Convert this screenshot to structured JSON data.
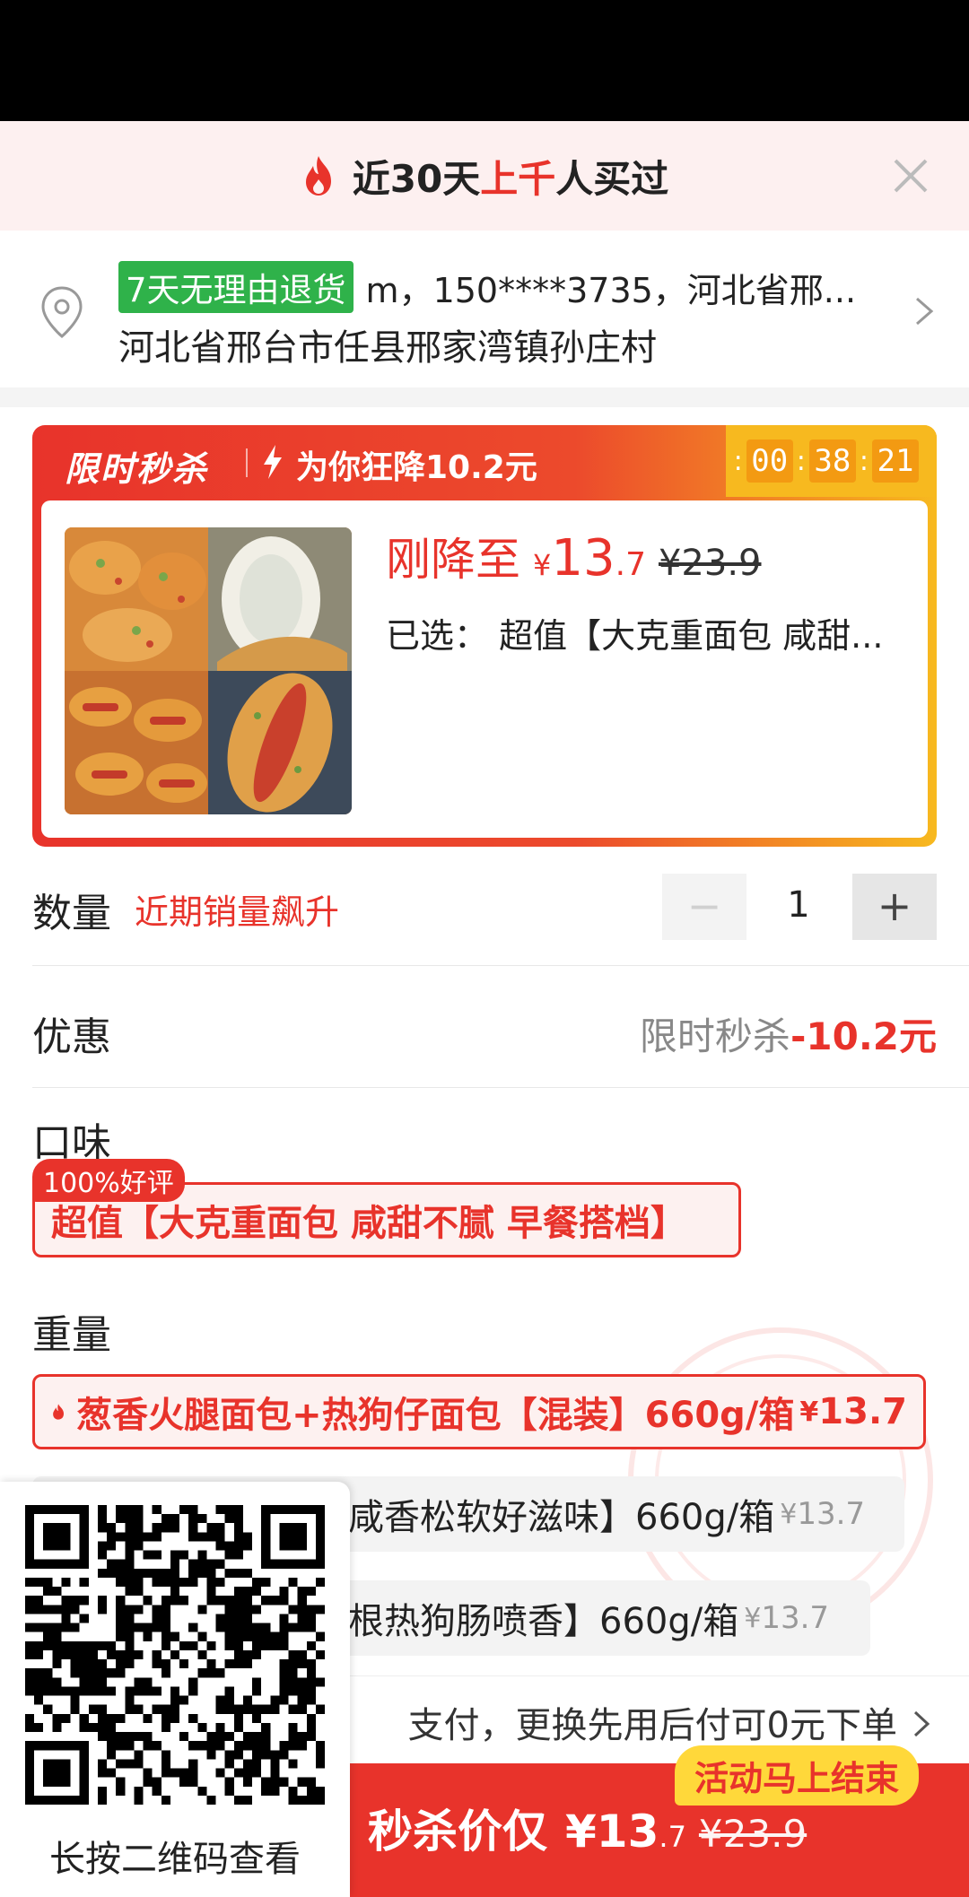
{
  "banner": {
    "text_before": "近30天",
    "text_highlight": "上千",
    "text_after": "人买过"
  },
  "address": {
    "tag": "7天无理由退货",
    "contact": "m，150****3735，河北省邢...",
    "detail": "河北省邢台市任县邢家湾镇孙庄村"
  },
  "flash_sale": {
    "title": "限时秒杀",
    "drop_text": "为你狂降10.2元",
    "timer": [
      "00",
      "38",
      "21"
    ]
  },
  "product": {
    "price_label": "刚降至",
    "currency": "¥",
    "price_int": "13",
    "price_dec": ".7",
    "orig_price": "¥23.9",
    "selected": "已选： 超值【大克重面包 咸甜..."
  },
  "quantity": {
    "label": "数量",
    "hint": "近期销量飙升",
    "minus": "−",
    "value": "1",
    "plus": "+"
  },
  "discount": {
    "label": "优惠",
    "name": "限时秒杀",
    "amount": "-10.2元"
  },
  "flavor": {
    "label": "口味",
    "badge": "100%好评",
    "option": "超值【大克重面包 咸甜不腻  早餐搭档】"
  },
  "weight": {
    "label": "重量",
    "options": [
      {
        "text": "葱香火腿面包+热狗仔面包【混装】660g/箱",
        "yen": "¥",
        "price": "13.7"
      },
      {
        "text": "咸香松软好滋味】660g/箱",
        "yen": "¥",
        "price": "13.7"
      },
      {
        "text": "根热狗肠喷香】660g/箱",
        "yen": "¥",
        "price": "13.7"
      }
    ]
  },
  "payment": {
    "text": "支付，更换先用后付可0元下单"
  },
  "buy": {
    "label": "秒杀价仅",
    "currency": "¥",
    "price_int": "13",
    "price_dec": ".7",
    "orig_price": "¥23.9",
    "ending_badge": "活动马上结束"
  },
  "qr": {
    "caption": "长按二维码查看"
  },
  "colors": {
    "accent": "#e8332b",
    "timer_bg": "#f7b91f",
    "tag_green": "#2fb24a",
    "ending_yellow": "#ffd83a"
  }
}
